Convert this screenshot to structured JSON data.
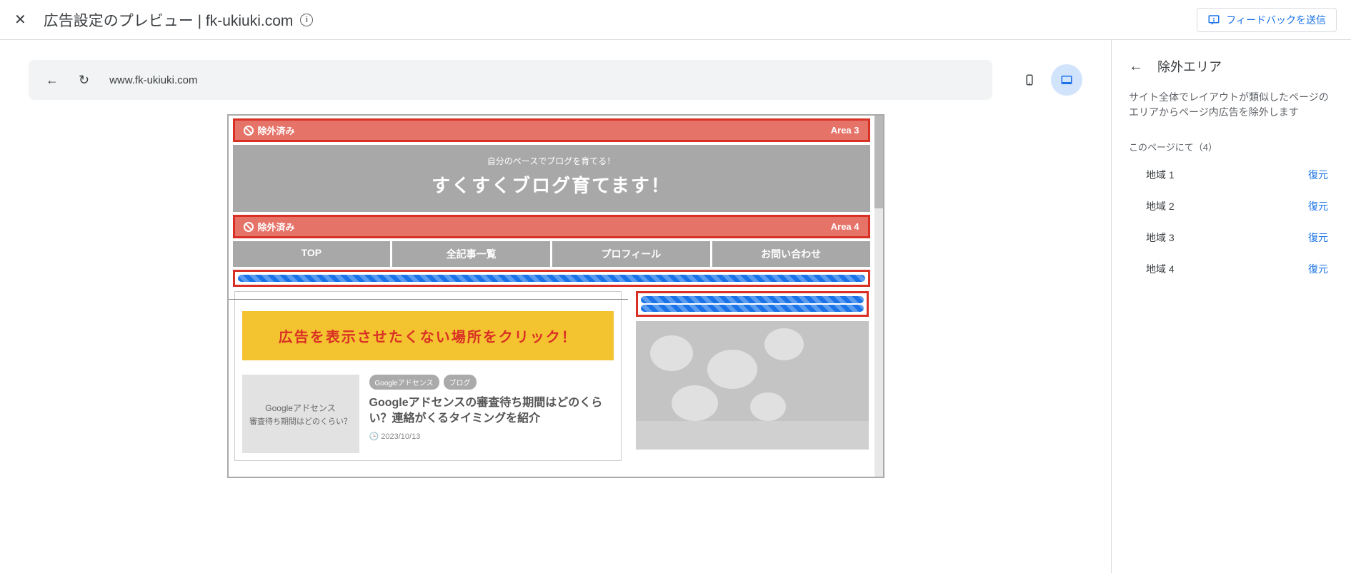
{
  "header": {
    "title": "広告設定のプレビュー | fk-ukiuki.com",
    "feedback_label": "フィードバックを送信"
  },
  "url_bar": {
    "url": "www.fk-ukiuki.com"
  },
  "excluded_banners": [
    {
      "label": "除外済み",
      "area": "Area 3"
    },
    {
      "label": "除外済み",
      "area": "Area 4"
    }
  ],
  "site": {
    "hero_sub": "自分のペースでブログを育てる！",
    "hero_title": "すくすくブログ育てます！",
    "nav": [
      "TOP",
      "全記事一覧",
      "プロフィール",
      "お問い合わせ"
    ],
    "yellow_banner": "広告を表示させたくない場所をクリック！",
    "article": {
      "tags": [
        "Googleアドセンス",
        "ブログ"
      ],
      "title": "Googleアドセンスの審査待ち期間はどのくらい？連絡がくるタイミングを紹介",
      "date": "2023/10/13",
      "thumb_line1": "Googleアドセンス",
      "thumb_line2": "審査待ち期間はどのくらい？"
    }
  },
  "side_panel": {
    "title": "除外エリア",
    "description": "サイト全体でレイアウトが類似したページのエリアからページ内広告を除外します",
    "sub_label": "このページにて（4）",
    "areas": [
      {
        "label": "地域 1",
        "action": "復元"
      },
      {
        "label": "地域 2",
        "action": "復元"
      },
      {
        "label": "地域 3",
        "action": "復元"
      },
      {
        "label": "地域 4",
        "action": "復元"
      }
    ]
  }
}
